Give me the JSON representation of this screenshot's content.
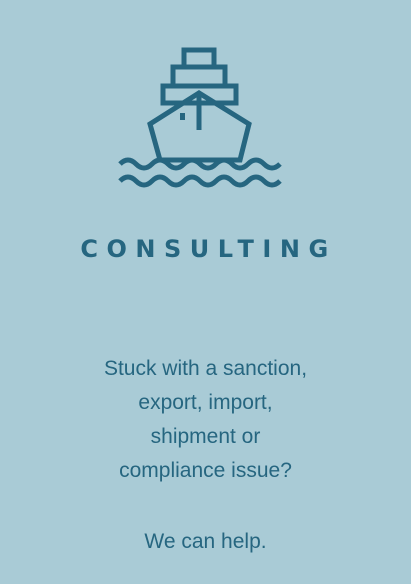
{
  "card": {
    "icon": "ship-icon",
    "title": "CONSULTING",
    "question_lines": [
      "Stuck with a sanction,",
      "export, import,",
      "shipment or",
      "compliance issue?"
    ],
    "help": "We can help."
  },
  "colors": {
    "background": "#a9cbd6",
    "accent": "#266680"
  }
}
